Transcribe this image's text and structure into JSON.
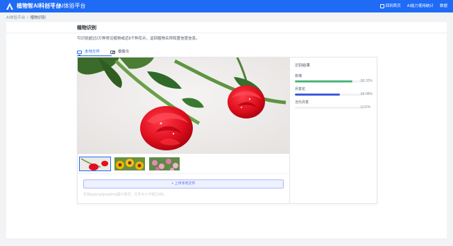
{
  "header": {
    "brand": "植物智AI科创平台",
    "subtitle": "AI体验平台",
    "nav": [
      "回到首页",
      "AI能力使用统计",
      "数据"
    ]
  },
  "breadcrumb": [
    "AI体验平台",
    "植物识别"
  ],
  "page": {
    "title": "植物识别",
    "description": "可识别超过2万种常见植物或近8千种花卉，返回植物名称和置信度信息。"
  },
  "tabs": [
    {
      "label": "本地文件",
      "icon": "monitor-icon",
      "active": true
    },
    {
      "label": "摄像头",
      "icon": "camera-icon",
      "active": false
    }
  ],
  "upload": {
    "button_label": "+ 上传本地文件",
    "hint": "支持jpg/png/jpeg/bmp图片格式，文件大小不超过4M。"
  },
  "thumbnails": [
    "red-roses",
    "sunflowers",
    "pink-flowers"
  ],
  "results": {
    "title": "识别结果",
    "items": [
      {
        "name": "玫瑰",
        "score": "83.32%",
        "ratio": 0.8332,
        "color": "#4cb67c"
      },
      {
        "name": "月季花",
        "score": "64.88%",
        "ratio": 0.6488,
        "color": "#3d5bd9"
      },
      {
        "name": "当代月季",
        "score": "0.02%",
        "ratio": 0.0002,
        "color": "#3d5bd9"
      }
    ]
  },
  "colors": {
    "primary": "#1f6bf5",
    "bg": "#f2f3f5"
  }
}
